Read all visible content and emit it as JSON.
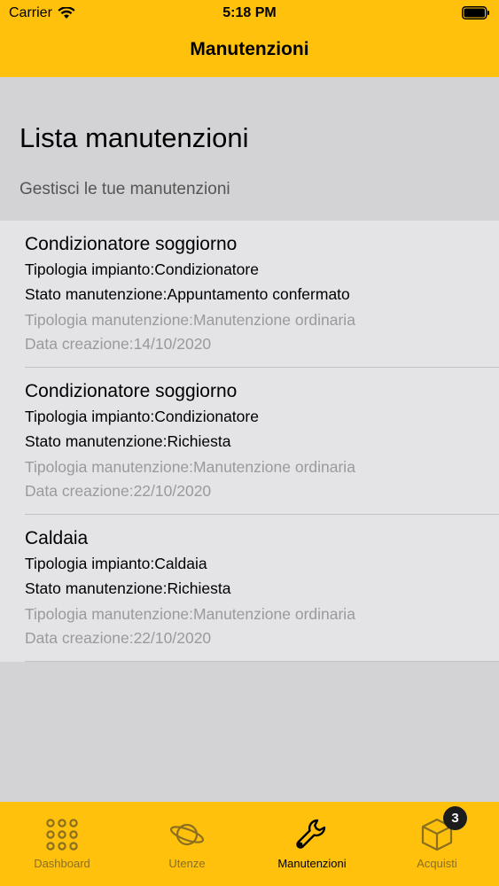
{
  "status_bar": {
    "carrier": "Carrier",
    "time": "5:18 PM"
  },
  "nav": {
    "title": "Manutenzioni"
  },
  "header": {
    "title": "Lista manutenzioni",
    "subtitle": "Gestisci le tue manutenzioni"
  },
  "items": [
    {
      "name": "Condizionatore soggiorno",
      "impianto_label": "Tipologia impianto:",
      "impianto": "Condizionatore",
      "stato_label": "Stato manutenzione:",
      "stato": "Appuntamento confermato",
      "tipologia_label": "Tipologia manutenzione:",
      "tipologia": "Manutenzione ordinaria",
      "data_label": "Data creazione:",
      "data": "14/10/2020"
    },
    {
      "name": "Condizionatore soggiorno",
      "impianto_label": "Tipologia impianto:",
      "impianto": "Condizionatore",
      "stato_label": "Stato manutenzione:",
      "stato": "Richiesta",
      "tipologia_label": "Tipologia manutenzione:",
      "tipologia": "Manutenzione ordinaria",
      "data_label": "Data creazione:",
      "data": "22/10/2020"
    },
    {
      "name": "Caldaia",
      "impianto_label": "Tipologia impianto:",
      "impianto": "Caldaia",
      "stato_label": "Stato manutenzione:",
      "stato": "Richiesta",
      "tipologia_label": "Tipologia manutenzione:",
      "tipologia": "Manutenzione ordinaria",
      "data_label": "Data creazione:",
      "data": "22/10/2020"
    }
  ],
  "tabs": [
    {
      "label": "Dashboard",
      "icon": "grid-dots-icon",
      "active": false
    },
    {
      "label": "Utenze",
      "icon": "planet-icon",
      "active": false
    },
    {
      "label": "Manutenzioni",
      "icon": "wrench-icon",
      "active": true
    },
    {
      "label": "Acquisti",
      "icon": "box-icon",
      "active": false,
      "badge": "3"
    }
  ],
  "colors": {
    "accent": "#ffc10b",
    "background": "#d3d3d6",
    "list_background": "#e4e3e6",
    "muted_text": "#9a9a9d"
  }
}
